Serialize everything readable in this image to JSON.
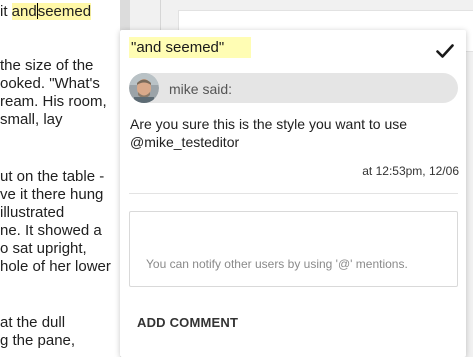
{
  "document": {
    "lines": [
      {
        "before": "it ",
        "highlight_a": "and",
        "highlight_b": "seemed"
      },
      {
        "text": ""
      },
      {
        "text": "the size of the"
      },
      {
        "text": "ooked. \"What's"
      },
      {
        "text": "ream. His room,"
      },
      {
        "text": "small, lay"
      },
      {
        "text": ""
      },
      {
        "text": "ut on the table -"
      },
      {
        "text": "ve it there hung"
      },
      {
        "text": "illustrated"
      },
      {
        "text": "ne. It showed a"
      },
      {
        "text": "o sat upright,"
      },
      {
        "text": "hole of her lower"
      },
      {
        "text": ""
      },
      {
        "text": "at the dull"
      },
      {
        "text": "g the pane,"
      }
    ]
  },
  "comment": {
    "quote": "\"and seemed\"",
    "author_label": "mike said:",
    "body": "Are you sure this is the style you want to use @mike_testeditor",
    "timestamp": "at 12:53pm, 12/06",
    "reply_placeholder": "You can notify other users by using '@' mentions.",
    "add_comment_label": "ADD COMMENT",
    "resolve_icon": "checkmark-icon",
    "highlight_color": "#fffdb4"
  }
}
